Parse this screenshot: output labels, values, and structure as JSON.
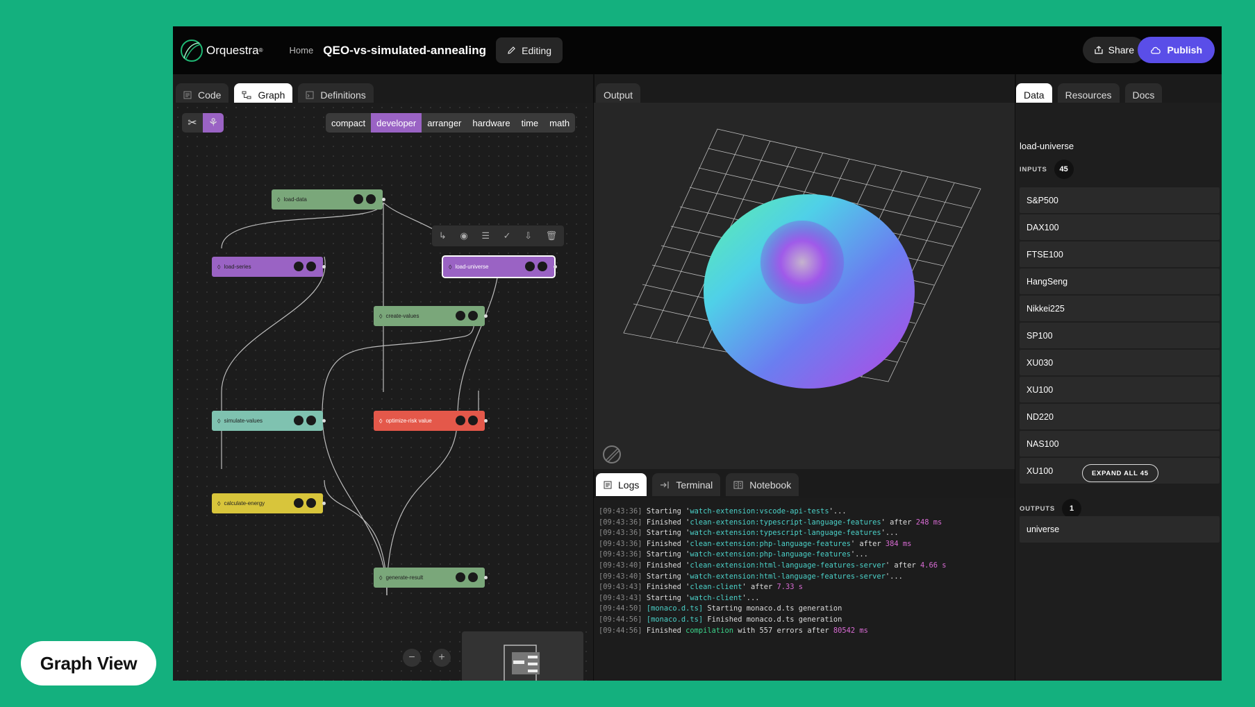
{
  "app": {
    "name": "Orquestra",
    "trademark": "®",
    "breadcrumb_home": "Home",
    "project_title": "QEO-vs-simulated-annealing",
    "edit_label": "Editing",
    "share_label": "Share",
    "publish_label": "Publish"
  },
  "left_tabs": [
    {
      "label": "Code"
    },
    {
      "label": "Graph"
    },
    {
      "label": "Definitions"
    }
  ],
  "layout_modes": [
    "compact",
    "developer",
    "arranger",
    "hardware",
    "time",
    "math"
  ],
  "active_layout": "developer",
  "nodes": [
    {
      "label": "load-data",
      "color": "#7aa77a"
    },
    {
      "label": "load-series",
      "color": "#9a63c4"
    },
    {
      "label": "load-universe",
      "color": "#9a63c4"
    },
    {
      "label": "create-values",
      "color": "#7aa77a"
    },
    {
      "label": "simulate-values",
      "color": "#7fc2b0"
    },
    {
      "label": "optimize-risk value",
      "color": "#e4584a"
    },
    {
      "label": "calculate-energy",
      "color": "#d8c53b"
    },
    {
      "label": "generate-result",
      "color": "#7aa77a"
    }
  ],
  "output_tab": "Output",
  "bottom_tabs": [
    {
      "label": "Logs"
    },
    {
      "label": "Terminal"
    },
    {
      "label": "Notebook"
    }
  ],
  "logs": [
    {
      "t": "[09:43:36]",
      "parts": [
        [
          "",
          "Starting '"
        ],
        [
          "c",
          "watch-extension:vscode-api-tests"
        ],
        [
          "",
          "'..."
        ]
      ]
    },
    {
      "t": "[09:43:36]",
      "parts": [
        [
          "",
          "Finished '"
        ],
        [
          "c",
          "clean-extension:typescript-language-features"
        ],
        [
          "",
          "' after "
        ],
        [
          "m",
          "248 ms"
        ]
      ]
    },
    {
      "t": "[09:43:36]",
      "parts": [
        [
          "",
          "Starting '"
        ],
        [
          "c",
          "watch-extension:typescript-language-features"
        ],
        [
          "",
          "'..."
        ]
      ]
    },
    {
      "t": "[09:43:36]",
      "parts": [
        [
          "",
          "Finished '"
        ],
        [
          "c",
          "clean-extension:php-language-features"
        ],
        [
          "",
          "' after "
        ],
        [
          "m",
          "384 ms"
        ]
      ]
    },
    {
      "t": "[09:43:36]",
      "parts": [
        [
          "",
          "Starting '"
        ],
        [
          "c",
          "watch-extension:php-language-features"
        ],
        [
          "",
          "'..."
        ]
      ]
    },
    {
      "t": "[09:43:40]",
      "parts": [
        [
          "",
          "Finished '"
        ],
        [
          "c",
          "clean-extension:html-language-features-server"
        ],
        [
          "",
          "' after "
        ],
        [
          "m",
          "4.66 s"
        ]
      ]
    },
    {
      "t": "[09:43:40]",
      "parts": [
        [
          "",
          "Starting '"
        ],
        [
          "c",
          "watch-extension:html-language-features-server"
        ],
        [
          "",
          "'..."
        ]
      ]
    },
    {
      "t": "[09:43:43]",
      "parts": [
        [
          "",
          "Finished '"
        ],
        [
          "c",
          "clean-client"
        ],
        [
          "",
          "' after "
        ],
        [
          "m",
          "7.33 s"
        ]
      ]
    },
    {
      "t": "[09:43:43]",
      "parts": [
        [
          "",
          "Starting '"
        ],
        [
          "c",
          "watch-client"
        ],
        [
          "",
          "'..."
        ]
      ]
    },
    {
      "t": "[09:44:50]",
      "parts": [
        [
          "c",
          "[monaco.d.ts]"
        ],
        [
          "",
          " Starting monaco.d.ts generation"
        ]
      ]
    },
    {
      "t": "[09:44:56]",
      "parts": [
        [
          "c",
          "[monaco.d.ts]"
        ],
        [
          "",
          " Finished monaco.d.ts generation"
        ]
      ]
    },
    {
      "t": "[09:44:56]",
      "parts": [
        [
          "",
          "Finished "
        ],
        [
          "g",
          "compilation"
        ],
        [
          "",
          " with 557 errors after "
        ],
        [
          "m",
          "80542 ms"
        ]
      ]
    }
  ],
  "right_tabs": [
    {
      "label": "Data"
    },
    {
      "label": "Resources"
    },
    {
      "label": "Docs"
    }
  ],
  "data_panel": {
    "node_title": "load-universe",
    "inputs_label": "INPUTS",
    "inputs_count": "45",
    "inputs": [
      "S&P500",
      "DAX100",
      "FTSE100",
      "HangSeng",
      "Nikkei225",
      "SP100",
      "XU030",
      "XU100",
      "ND220",
      "NAS100",
      "XU100"
    ],
    "expand_label": "EXPAND ALL 45",
    "outputs_label": "OUTPUTS",
    "outputs_count": "1",
    "outputs": [
      "universe"
    ]
  },
  "caption": "Graph View"
}
